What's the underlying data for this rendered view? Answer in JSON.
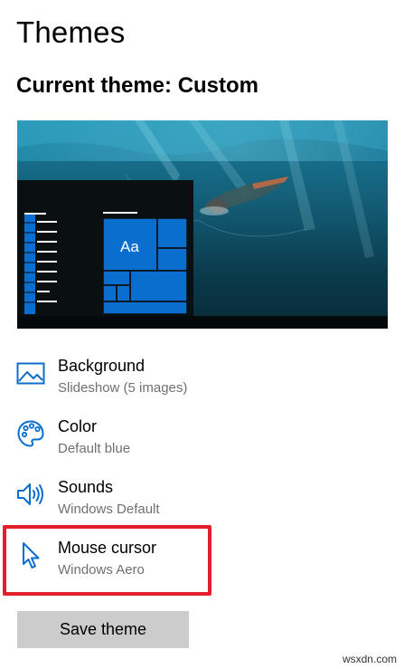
{
  "page": {
    "title": "Themes",
    "current_theme_label": "Current theme: Custom"
  },
  "preview": {
    "tile_label": "Aa"
  },
  "settings": [
    {
      "title": "Background",
      "subtitle": "Slideshow (5 images)",
      "icon": "picture-icon"
    },
    {
      "title": "Color",
      "subtitle": "Default blue",
      "icon": "palette-icon"
    },
    {
      "title": "Sounds",
      "subtitle": "Windows Default",
      "icon": "speaker-icon"
    },
    {
      "title": "Mouse cursor",
      "subtitle": "Windows Aero",
      "icon": "mouse-pointer-icon"
    }
  ],
  "actions": {
    "save_label": "Save theme"
  },
  "watermark": "wsxdn.com",
  "colors": {
    "accent": "#0a6ece",
    "highlight": "#e3202a",
    "button_bg": "#cccccc",
    "secondary_text": "#707070"
  }
}
